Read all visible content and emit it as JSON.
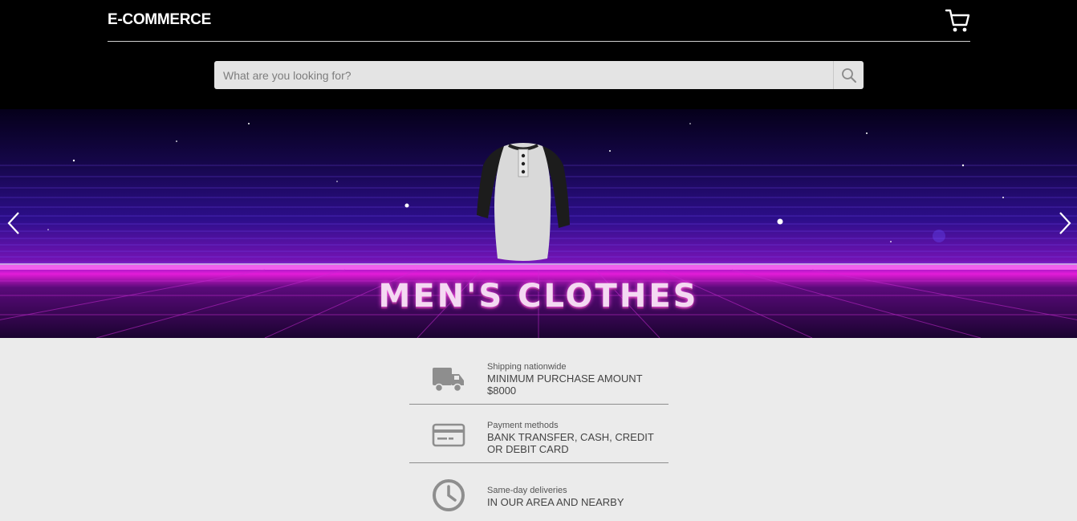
{
  "header": {
    "brand": "E-COMMERCE",
    "cart_icon": "shopping-cart-icon",
    "search": {
      "placeholder": "What are you looking for?",
      "value": "",
      "button_icon": "magnifier-icon"
    }
  },
  "banner": {
    "title": "MEN'S CLOTHES",
    "prev_icon": "chevron-left-icon",
    "next_icon": "chevron-right-icon",
    "colors": {
      "glow": "#e21cd8",
      "sky": "#2c0e8a"
    }
  },
  "features": [
    {
      "icon": "delivery-truck-icon",
      "label": "Shipping nationwide",
      "detail": "MINIMUM PURCHASE AMOUNT $8000"
    },
    {
      "icon": "credit-card-icon",
      "label": "Payment methods",
      "detail": "BANK TRANSFER, CASH, CREDIT OR DEBIT CARD"
    },
    {
      "icon": "clock-icon",
      "label": "Same-day deliveries",
      "detail": "IN OUR AREA AND NEARBY"
    }
  ]
}
